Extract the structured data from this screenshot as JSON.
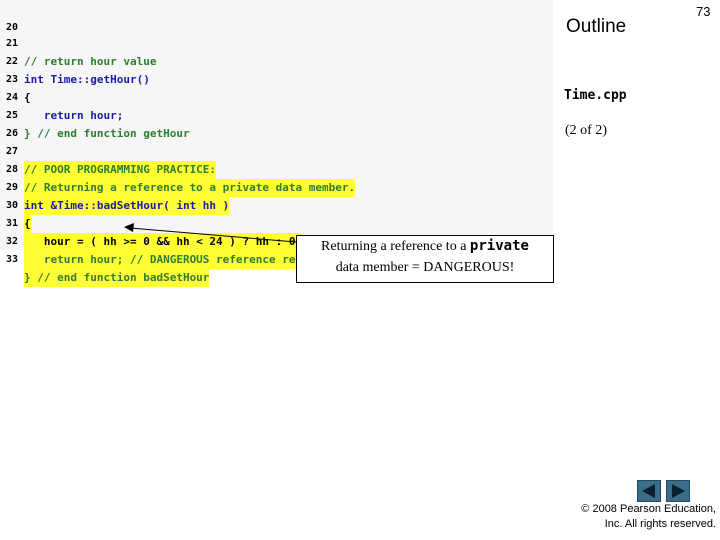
{
  "slide": {
    "outline_label": "Outline",
    "slide_number": "73",
    "filename": "Time.cpp",
    "page_info": "(2 of 2)",
    "callout_pre": "Returning a reference to a ",
    "callout_code": "private",
    "callout_post": "data member = DANGEROUS!",
    "copyright_line1": "© 2008 Pearson Education,",
    "copyright_line2": "Inc.  All rights reserved."
  },
  "code": {
    "lines": [
      {
        "n": "20",
        "text": ""
      },
      {
        "n": "21",
        "text": "// return hour value"
      },
      {
        "n": "22",
        "text": "int Time::getHour()"
      },
      {
        "n": "23",
        "text": "{"
      },
      {
        "n": "24",
        "text": "   return hour;"
      },
      {
        "n": "25",
        "text": "} // end function getHour"
      },
      {
        "n": "26",
        "text": ""
      },
      {
        "n": "27",
        "text": "// POOR PROGRAMMING PRACTICE:"
      },
      {
        "n": "28",
        "text": "// Returning a reference to a private data member."
      },
      {
        "n": "29",
        "text": "int &Time::badSetHour( int hh )"
      },
      {
        "n": "30",
        "text": "{"
      },
      {
        "n": "31",
        "text": "   hour = ( hh >= 0 && hh < 24 ) ? hh : 0;"
      },
      {
        "n": "32",
        "text": "   return hour; // DANGEROUS reference return"
      },
      {
        "n": "33",
        "text": "} // end function badSetHour"
      }
    ]
  },
  "nav": {
    "prev_icon": "left-triangle-icon",
    "next_icon": "right-triangle-icon"
  },
  "colors": {
    "highlight": "#ffff33",
    "comment": "#2e7d32",
    "keyword": "#1a1aa6",
    "nav_button": "#3c6d88"
  }
}
